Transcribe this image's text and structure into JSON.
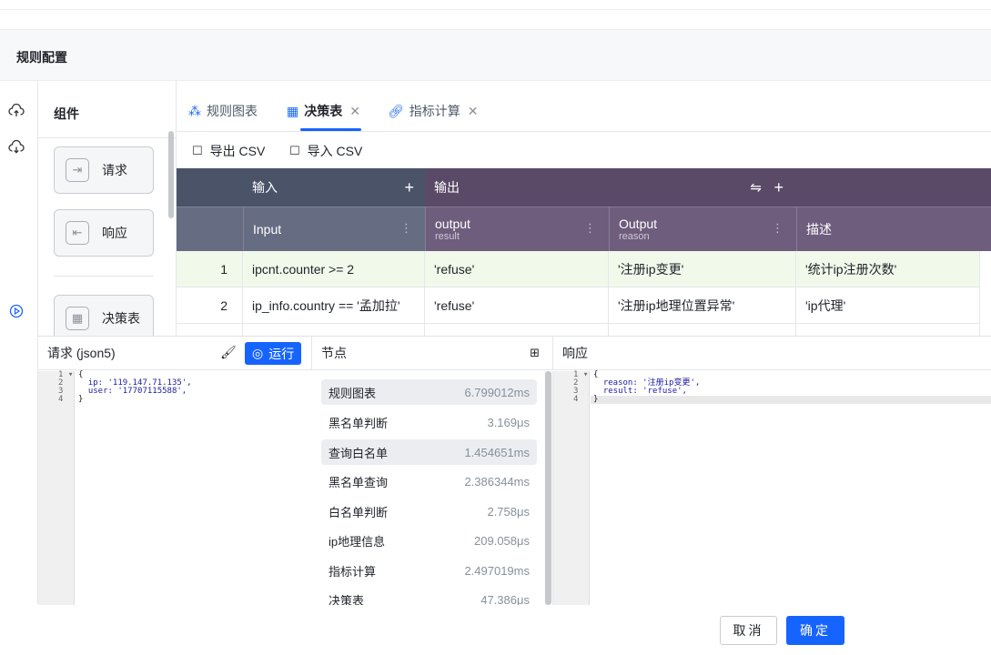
{
  "page": {
    "title": "规则配置"
  },
  "components": {
    "title": "组件",
    "items": [
      {
        "label": "请求",
        "icon": "request-icon"
      },
      {
        "label": "响应",
        "icon": "response-icon"
      },
      {
        "label": "决策表",
        "icon": "table-icon"
      }
    ]
  },
  "tabs": [
    {
      "label": "规则图表",
      "icon": "graph-icon",
      "active": false
    },
    {
      "label": "决策表",
      "icon": "table-icon",
      "active": true,
      "close": "✕"
    },
    {
      "label": "指标计算",
      "icon": "metric-icon",
      "active": false,
      "close": "✕"
    }
  ],
  "toolbar": {
    "export": "导出 CSV",
    "import": "导入 CSV"
  },
  "table": {
    "group_input": "输入",
    "group_output": "输出",
    "add_symbol": "+",
    "swap_symbol": "⇋",
    "menu_symbol": "⋮",
    "columns": [
      {
        "title": "Input",
        "sub": ""
      },
      {
        "title": "output",
        "sub": "result"
      },
      {
        "title": "Output",
        "sub": "reason"
      },
      {
        "title": "描述",
        "sub": ""
      }
    ],
    "rows": [
      {
        "idx": "1",
        "input": "ipcnt.counter >= 2",
        "result": "'refuse'",
        "reason": "'注册ip变更'",
        "desc": "'统计ip注册次数'"
      },
      {
        "idx": "2",
        "input": "ip_info.country == '孟加拉'",
        "result": "'refuse'",
        "reason": "'注册ip地理位置异常'",
        "desc": "'ip代理'"
      }
    ]
  },
  "request": {
    "title": "请求 (json5)",
    "run": "运行",
    "lines": [
      "{",
      "  ip: '119.147.71.135',",
      "  user: '17707115588',",
      "}"
    ],
    "line_numbers": [
      "1 ▾",
      "2",
      "3",
      "4"
    ]
  },
  "nodes": {
    "title": "节点",
    "items": [
      {
        "name": "规则图表",
        "time": "6.799012ms",
        "highlight": true
      },
      {
        "name": "黑名单判断",
        "time": "3.169μs",
        "highlight": false
      },
      {
        "name": "查询白名单",
        "time": "1.454651ms",
        "highlight": true
      },
      {
        "name": "黑名单查询",
        "time": "2.386344ms",
        "highlight": false
      },
      {
        "name": "白名单判断",
        "time": "2.758μs",
        "highlight": false
      },
      {
        "name": "ip地理信息",
        "time": "209.058μs",
        "highlight": false
      },
      {
        "name": "指标计算",
        "time": "2.497019ms",
        "highlight": false
      },
      {
        "name": "决策表",
        "time": "47.386μs",
        "highlight": false
      }
    ]
  },
  "response": {
    "title": "响应",
    "lines": [
      "{",
      "  reason: '注册ip变更',",
      "  result: 'refuse',",
      "}"
    ],
    "line_numbers": [
      "1 ▾",
      "2",
      "3",
      "4"
    ]
  },
  "footer": {
    "cancel": "取消",
    "ok": "确定"
  },
  "colors": {
    "accent": "#1664ff",
    "input_header": "#4b5369",
    "output_header": "#5a4a67"
  }
}
